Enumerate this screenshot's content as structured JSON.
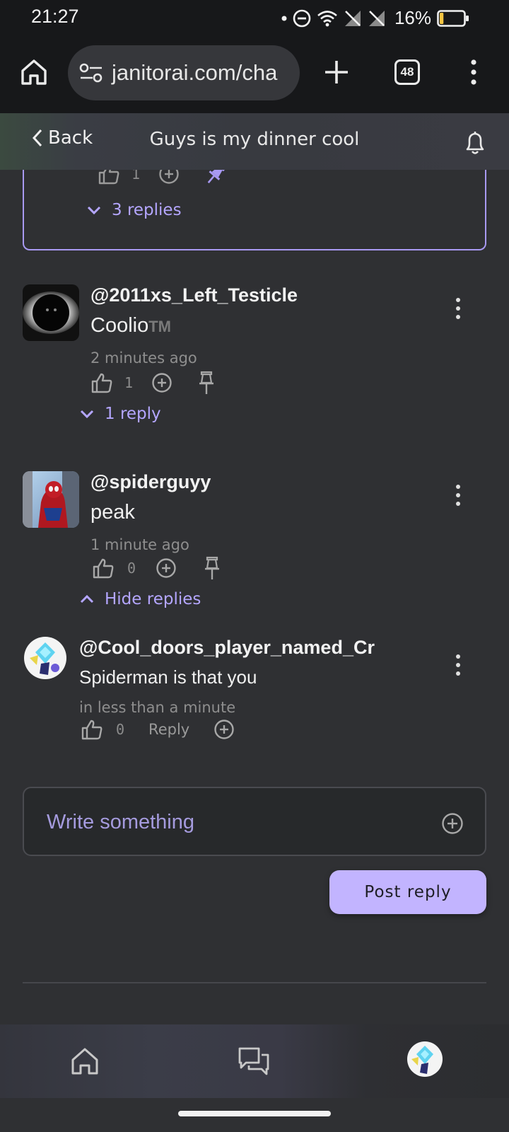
{
  "status": {
    "time": "21:27",
    "battery": "16%",
    "battery_level": 0.16
  },
  "browser": {
    "url": "janitorai.com/cha",
    "tab_count": "48"
  },
  "header": {
    "back_label": "Back",
    "title": "Guys is my dinner cool"
  },
  "pinned": {
    "likes": "1",
    "replies_label": "3 replies"
  },
  "comments": [
    {
      "username": "@2011xs_Left_Testicle",
      "text": "Coolio",
      "suffix": "TM",
      "time": "2 minutes ago",
      "likes": "1",
      "replies_label": "1 reply"
    },
    {
      "username": "@spiderguyy",
      "text": "peak",
      "time": "1 minute ago",
      "likes": "0",
      "replies_label": "Hide replies"
    }
  ],
  "reply": {
    "username": "@Cool_doors_player_named_Cr",
    "text": "Spiderman is that you",
    "time": "in less than a minute",
    "likes": "0",
    "reply_label": "Reply"
  },
  "composer": {
    "placeholder": "Write something",
    "post_label": "Post reply"
  },
  "colors": {
    "accent": "#c2b4ff",
    "accent_text": "#b4a6ff",
    "pinned_border": "#a899f2",
    "background": "#2f3033"
  }
}
